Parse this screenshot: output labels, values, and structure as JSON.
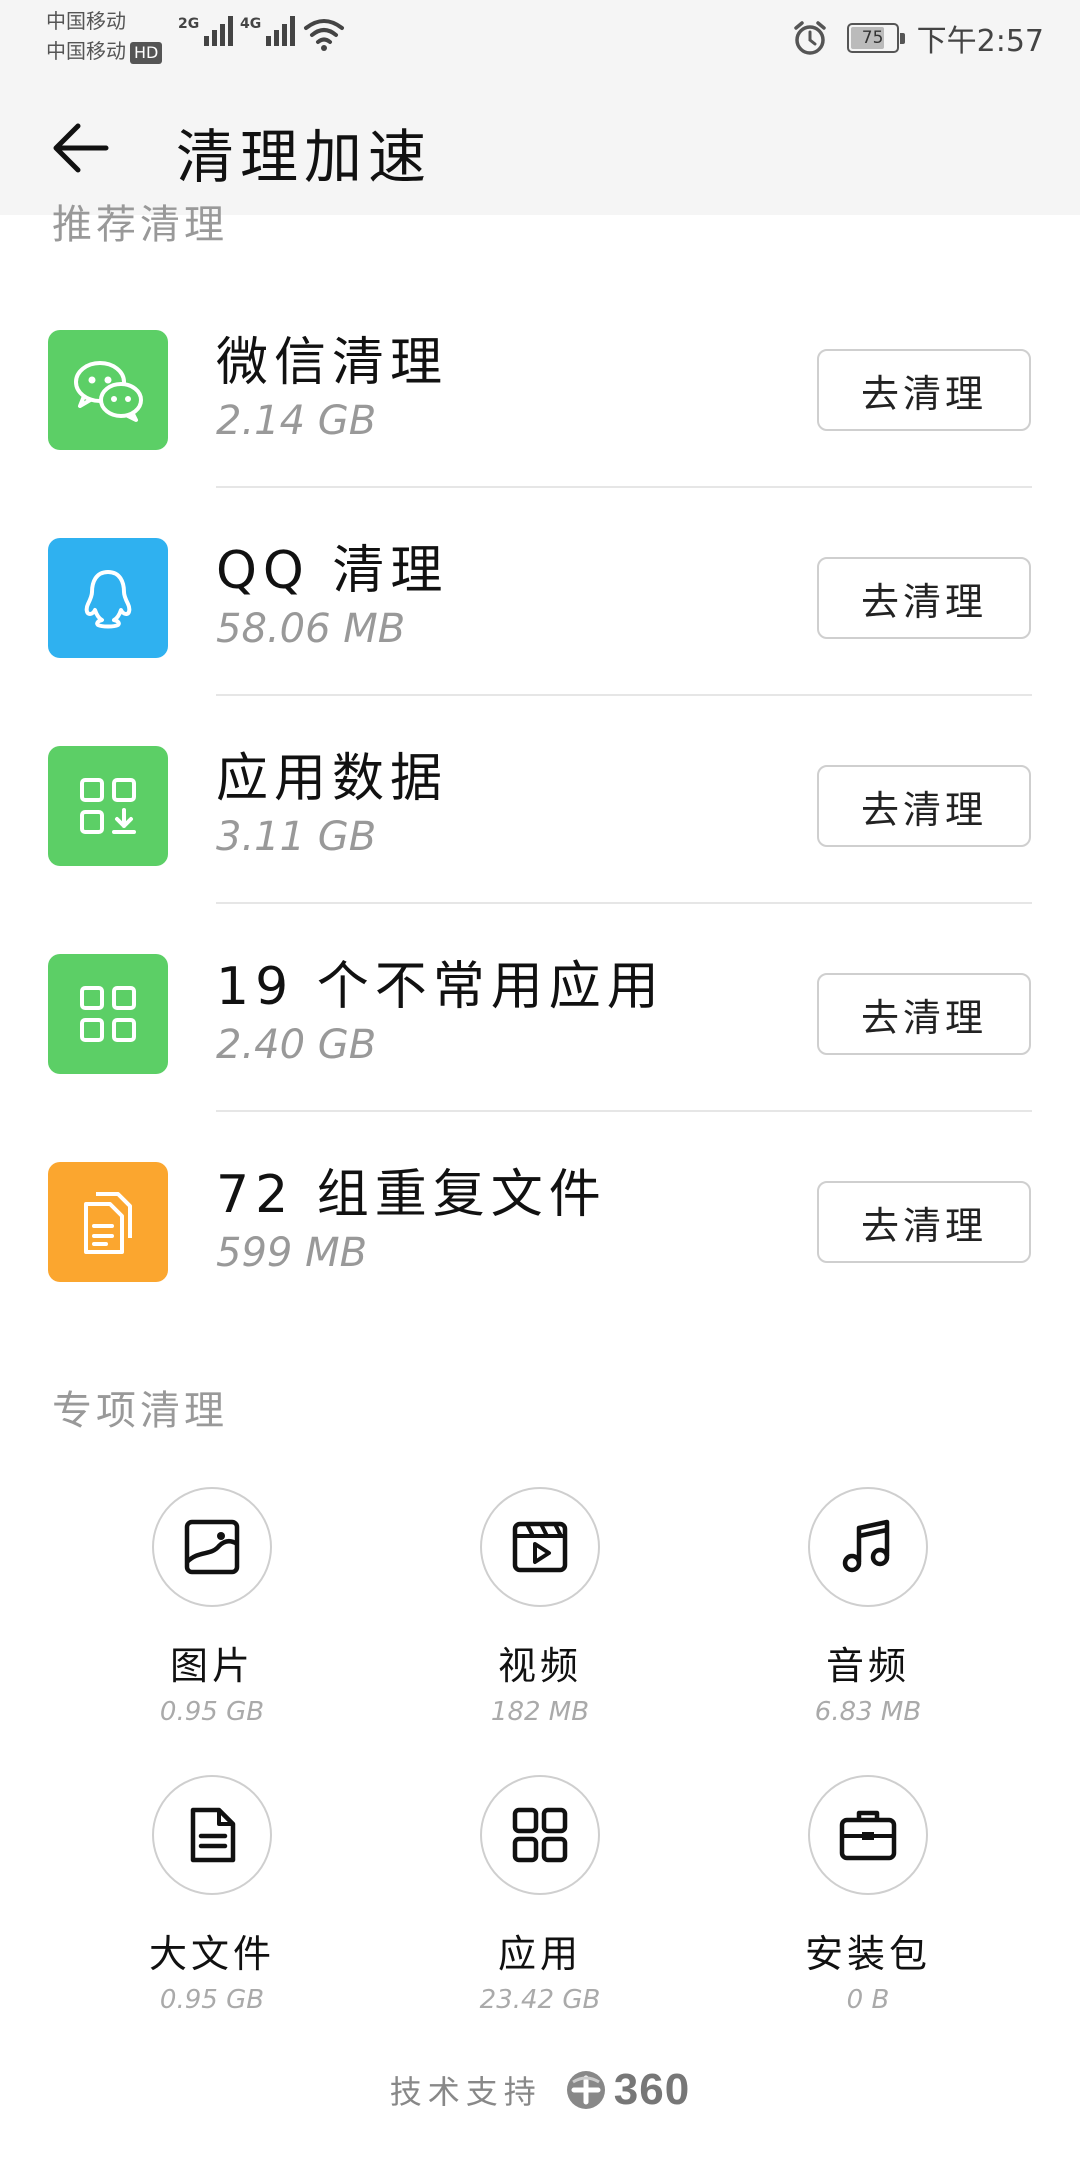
{
  "status_bar": {
    "carrier_1": "中国移动",
    "carrier_2": "中国移动",
    "hd_badge": "HD",
    "sig_1_label": "2G",
    "sig_2_label": "4G",
    "battery": "75",
    "time": "下午2:57",
    "icons": [
      "signal-icon",
      "wifi-icon",
      "alarm-icon",
      "battery-icon"
    ]
  },
  "header": {
    "title": "清理加速"
  },
  "recommended": {
    "label": "推荐清理",
    "items": [
      {
        "name": "微信清理",
        "size": "2.14 GB",
        "button": "去清理",
        "icon": "wechat-icon",
        "color": "#5ccf66"
      },
      {
        "name": "QQ 清理",
        "size": "58.06 MB",
        "button": "去清理",
        "icon": "qq-icon",
        "color": "#2fb1f0"
      },
      {
        "name": "应用数据",
        "size": "3.11 GB",
        "button": "去清理",
        "icon": "app-data-icon",
        "color": "#5ccf66"
      },
      {
        "name": "19 个不常用应用",
        "size": "2.40 GB",
        "button": "去清理",
        "icon": "apps-grid-icon",
        "color": "#5ccf66"
      },
      {
        "name": "72 组重复文件",
        "size": "599 MB",
        "button": "去清理",
        "icon": "duplicate-files-icon",
        "color": "#fba62f"
      }
    ]
  },
  "special": {
    "label": "专项清理",
    "items": [
      {
        "name": "图片",
        "size": "0.95 GB",
        "icon": "image-icon"
      },
      {
        "name": "视频",
        "size": "182 MB",
        "icon": "video-icon"
      },
      {
        "name": "音频",
        "size": "6.83 MB",
        "icon": "music-icon"
      },
      {
        "name": "大文件",
        "size": "0.95 GB",
        "icon": "document-icon"
      },
      {
        "name": "应用",
        "size": "23.42 GB",
        "icon": "apps-icon"
      },
      {
        "name": "安装包",
        "size": "0 B",
        "icon": "briefcase-icon"
      }
    ]
  },
  "footer": {
    "text": "技术支持",
    "logo_text": "360"
  }
}
